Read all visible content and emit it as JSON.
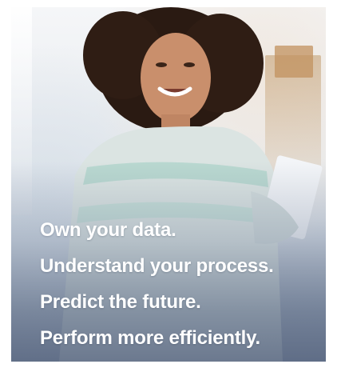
{
  "hero": {
    "lines": [
      "Own your data.",
      "Understand your process.",
      "Predict the future.",
      "Perform more efficiently."
    ]
  },
  "colors": {
    "headline": "#ffffff",
    "overlay": "#5f6e87"
  },
  "image": {
    "subject": "smiling woman holding papers"
  }
}
